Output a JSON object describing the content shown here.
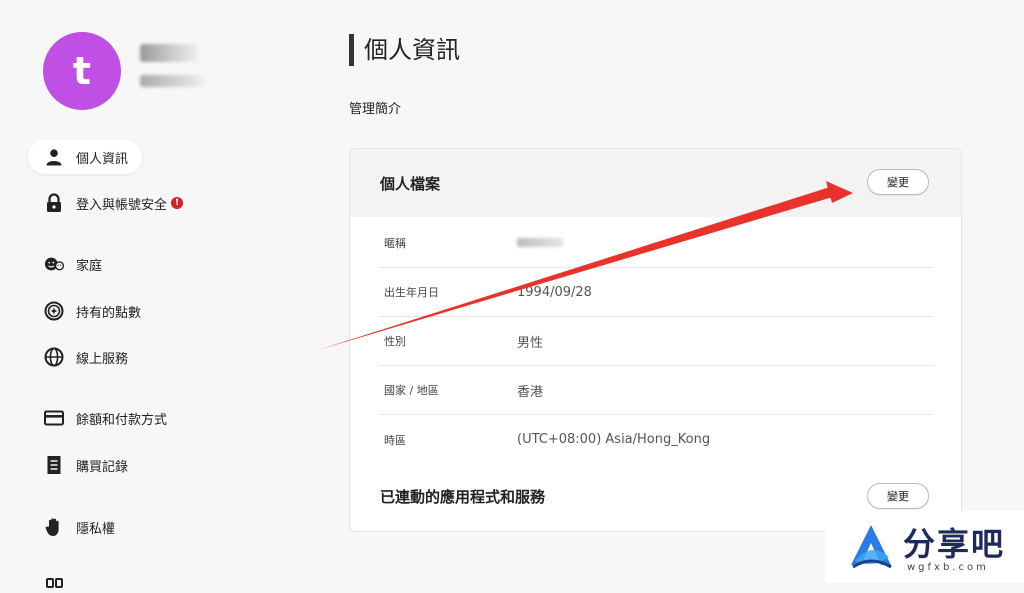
{
  "profile": {
    "avatar_letter": "t"
  },
  "sidebar": {
    "items": [
      {
        "label": "個人資訊",
        "icon": "person-icon",
        "active": true
      },
      {
        "label": "登入與帳號安全",
        "icon": "lock-icon",
        "alert": "!"
      },
      {
        "label": "家庭",
        "icon": "family-icon"
      },
      {
        "label": "持有的點數",
        "icon": "points-icon"
      },
      {
        "label": "線上服務",
        "icon": "globe-icon"
      },
      {
        "label": "餘額和付款方式",
        "icon": "card-icon"
      },
      {
        "label": "購買記錄",
        "icon": "receipt-icon"
      },
      {
        "label": "隱私權",
        "icon": "hand-icon"
      }
    ]
  },
  "main": {
    "title": "個人資訊",
    "subtitle": "管理簡介",
    "profile_card": {
      "title": "個人檔案",
      "change_label": "變更",
      "rows": [
        {
          "label": "暱稱",
          "value": ""
        },
        {
          "label": "出生年月日",
          "value": "1994/09/28"
        },
        {
          "label": "性別",
          "value": "男性"
        },
        {
          "label": "國家 / 地區",
          "value": "香港"
        },
        {
          "label": "時區",
          "value": "(UTC+08:00) Asia/Hong_Kong"
        }
      ]
    },
    "linked_section": {
      "title": "已連動的應用程式和服務",
      "change_label": "變更"
    }
  },
  "annotation": {
    "arrow_color": "#e8322b"
  },
  "watermark": {
    "text": "分享吧",
    "sub": "wgfxb.com"
  }
}
